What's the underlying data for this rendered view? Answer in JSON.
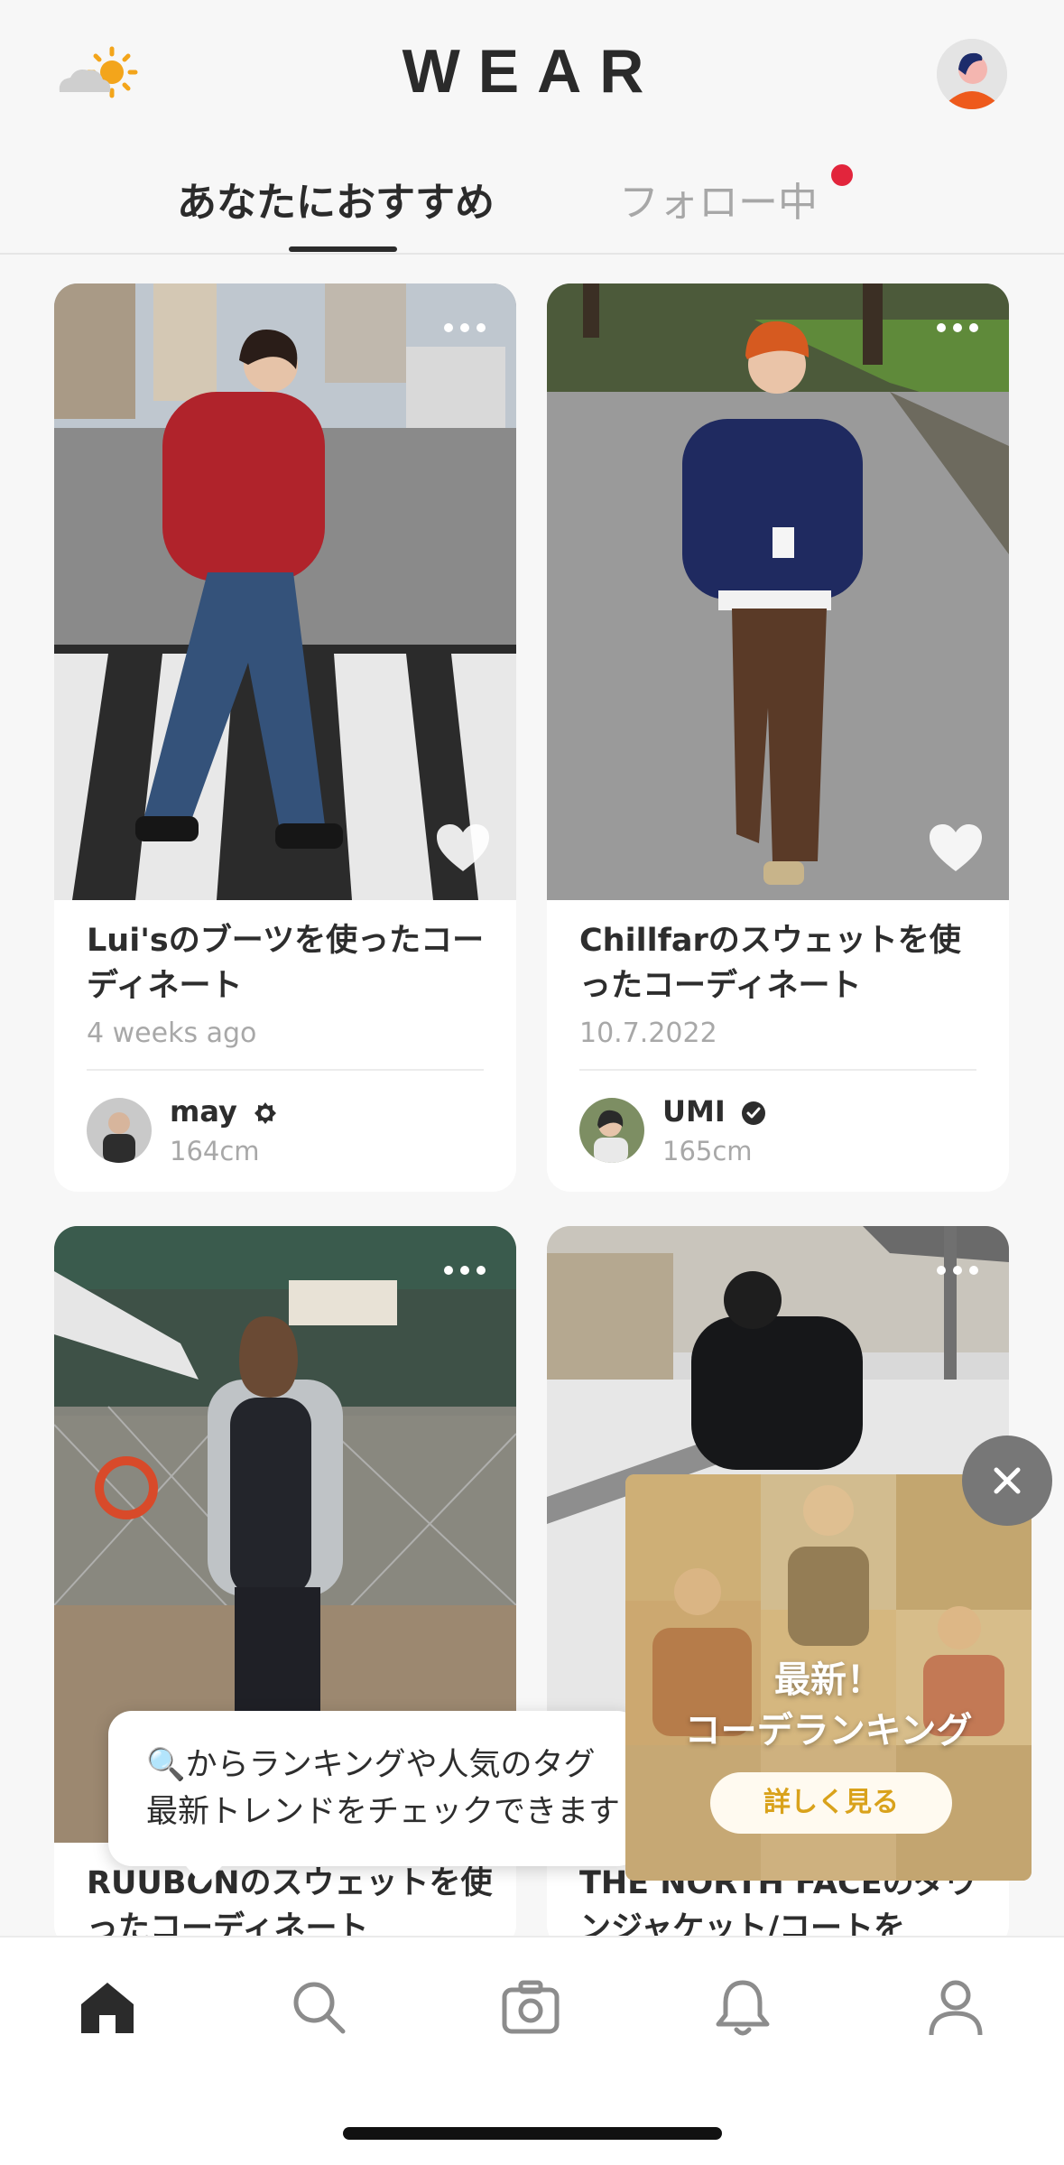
{
  "header": {
    "logo": "WEAR",
    "tabs": [
      {
        "label": "あなたにおすすめ",
        "active": true
      },
      {
        "label": "フォロー中",
        "active": false,
        "has_notification": true
      }
    ]
  },
  "posts": [
    {
      "title": "Lui'sのブーツを使ったコーディネート",
      "date": "4 weeks ago",
      "user": "may",
      "height": "164cm"
    },
    {
      "title": "Chillfarのスウェットを使ったコーディネート",
      "date": "10.7.2022",
      "user": "UMI",
      "height": "165cm"
    },
    {
      "title": "RUUBONのスウェットを使ったコーディネート"
    },
    {
      "title": "THE NORTH FACEのダウンジャケット/コートを"
    }
  ],
  "tooltip": {
    "text": "🔍からランキングや人気のタグ\n最新トレンドをチェックできます"
  },
  "banner": {
    "headline": "最新！\nコーデランキング",
    "button": "詳しく見る"
  },
  "tabbar": {
    "items": [
      "home-icon",
      "search-icon",
      "camera-icon",
      "bell-icon",
      "profile-icon"
    ],
    "active": "home-icon"
  },
  "colors": {
    "accent": "#d9a21b",
    "notification": "#e2253c",
    "text": "#2b2b2b"
  }
}
